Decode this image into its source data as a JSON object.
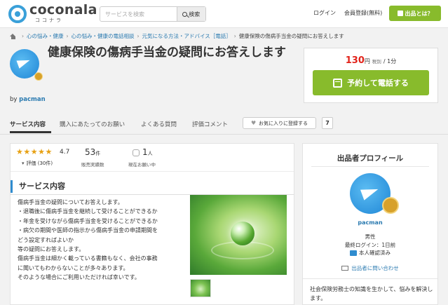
{
  "header": {
    "logo_name": "coconala",
    "logo_sub": "ココナラ",
    "search_placeholder": "サービスを検索",
    "search_button": "検索",
    "login": "ログイン",
    "register": "会員登録(無料)",
    "about_button": "出品とは？"
  },
  "breadcrumb": [
    "心の悩み・健康",
    "心の悩み・健康の電話相談",
    "元気になる方法・アドバイス［電話］",
    "健康保険の傷病手当金の疑問にお答えします"
  ],
  "service": {
    "title": "健康保険の傷病手当金の疑問にお答えします",
    "by_prefix": "by",
    "seller": "pacman",
    "price": "130",
    "price_unit": "円",
    "tax": "税別",
    "per": "/ 1分",
    "book_button": "予約して電話する"
  },
  "tabs": [
    "サービス内容",
    "購入にあたってのお願い",
    "よくある質問",
    "評価コメント"
  ],
  "favorite": {
    "label": "お気に入りに登録する",
    "count": "7"
  },
  "stats": {
    "rating": "4.7",
    "review_label": "評価 (30件)",
    "sales": "53",
    "sales_unit": "件",
    "sales_label": "販売実績数",
    "requests": "1",
    "requests_unit": "人",
    "requests_label": "現在お願い中",
    "rating_stars": 4.7
  },
  "content": {
    "section_title": "サービス内容",
    "description": "傷病手当金の疑問についてお答えします。\n・退職後に傷病手当金を継続して受けることができるか\n・年金を受けながら傷病手当金を受けることができるか\n・病欠の期間や医師の指示から傷病手当金の申請期間を\nどう設定すればよいか\n等の疑問にお答えします。\n傷病手当金は細かく載っている書籍もなく、会社の事務\nに聞いてもわからないことが多々あります。\nそのような場合にご利用いただければ幸いです。"
  },
  "profile": {
    "title": "出品者プロフィール",
    "name": "pacman",
    "gender": "男性",
    "last_login": "最終ログイン：1日前",
    "verified": "本人確認済み",
    "contact": "出品者に問い合わせ",
    "bio": "社会保険労務士の知識を生かして、悩みを解決します。"
  },
  "colors": {
    "accent_green": "#88bb2c",
    "link_blue": "#2a7ab0",
    "price_red": "#e2231a",
    "star": "#e7a114"
  }
}
